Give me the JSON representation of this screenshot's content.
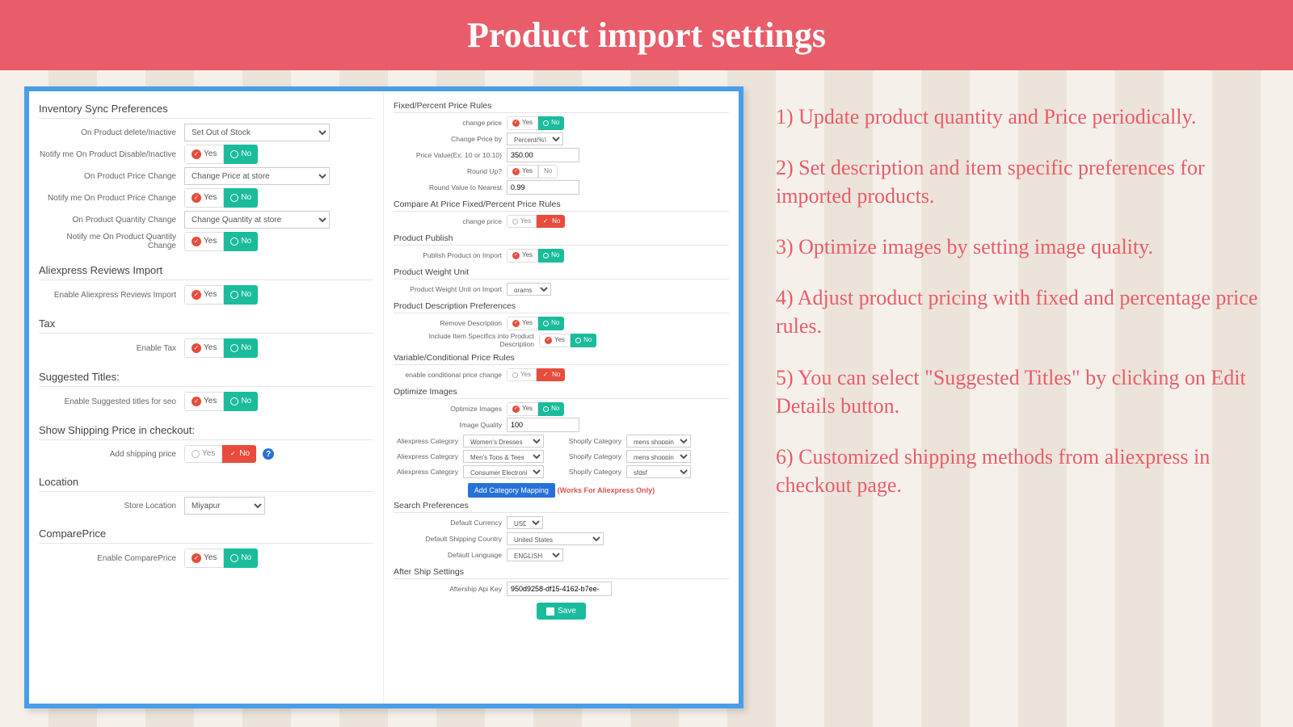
{
  "header": {
    "title": "Product import settings"
  },
  "notes": [
    "1) Update product quantity and Price periodically.",
    "2) Set description and item specific preferences for imported products.",
    "3) Optimize images by setting image quality.",
    "4) Adjust product pricing with fixed and percentage price rules.",
    "5) You can select \"Suggested Titles\" by clicking on Edit Details button.",
    "6) Customized shipping methods from aliexpress in checkout page."
  ],
  "left": {
    "inventory": {
      "title": "Inventory Sync Preferences",
      "on_delete_label": "On Product delete/Inactive",
      "on_delete_value": "Set Out of Stock",
      "notify_disable_label": "Notify me On Product Disable/Inactive",
      "on_price_label": "On Product Price Change",
      "on_price_value": "Change Price at store",
      "notify_price_label": "Notify me On Product Price Change",
      "on_qty_label": "On Product Quantity Change",
      "on_qty_value": "Change Quantity at store",
      "notify_qty_label": "Notify me On Product Quantity Change"
    },
    "reviews": {
      "title": "Aliexpress Reviews Import",
      "enable_label": "Enable Aliexpress Reviews Import"
    },
    "tax": {
      "title": "Tax",
      "enable_label": "Enable Tax"
    },
    "titles": {
      "title": "Suggested Titles:",
      "enable_label": "Enable Suggested titles for seo"
    },
    "shipping": {
      "title": "Show Shipping Price in checkout:",
      "add_label": "Add shipping price"
    },
    "location": {
      "title": "Location",
      "store_label": "Store Location",
      "store_value": "Miyapur"
    },
    "compare": {
      "title": "ComparePrice",
      "enable_label": "Enable ComparePrice"
    }
  },
  "right": {
    "fixed": {
      "title": "Fixed/Percent Price Rules",
      "change_price_label": "change price",
      "change_by_label": "Change Price by",
      "change_by_value": "Percent(%)",
      "price_value_label": "Price Value(Ex. 10 or 10.10)",
      "price_value": "350.00",
      "round_label": "Round Up?",
      "round_nearest_label": "Round Value to Nearest",
      "round_nearest_value": "0.99"
    },
    "compare_at": {
      "title": "Compare At Price Fixed/Percent Price Rules",
      "change_price_label": "change price"
    },
    "publish": {
      "title": "Product Publish",
      "label": "Publish Product on Import"
    },
    "weight": {
      "title": "Product Weight Unit",
      "label": "Product Weight Unit on Import",
      "value": "grams"
    },
    "desc": {
      "title": "Product Description Preferences",
      "remove_label": "Remove Description",
      "include_label": "Include Item Specifics into Product Description"
    },
    "variable": {
      "title": "Variable/Conditional Price Rules",
      "label": "enable conditional price change"
    },
    "images": {
      "title": "Optimize Images",
      "opt_label": "Optimize Images",
      "quality_label": "Image Quality",
      "quality_value": "100",
      "ali_cat_label": "Aliexpress Category",
      "shop_cat_label": "Shopify Category",
      "ali1": "Women's Dresses",
      "shop1": "mens shopping",
      "ali2": "Men's Tops & Tees",
      "shop2": "mens shopping",
      "ali3": "Consumer Electronics",
      "shop3": "sfdsf",
      "add_btn": "Add Category Mapping",
      "warn": "(Works For Aliexpress Only)"
    },
    "search": {
      "title": "Search Preferences",
      "currency_label": "Default Currency",
      "currency_value": "USD",
      "country_label": "Default Shipping Country",
      "country_value": "United States",
      "lang_label": "Default Language",
      "lang_value": "ENGLISH"
    },
    "aftership": {
      "title": "After Ship Settings",
      "label": "Aftership Api Key",
      "value": "950d9258-df15-4162-b7ee-"
    },
    "save": "Save"
  },
  "toggle": {
    "yes": "Yes",
    "no": "No"
  }
}
